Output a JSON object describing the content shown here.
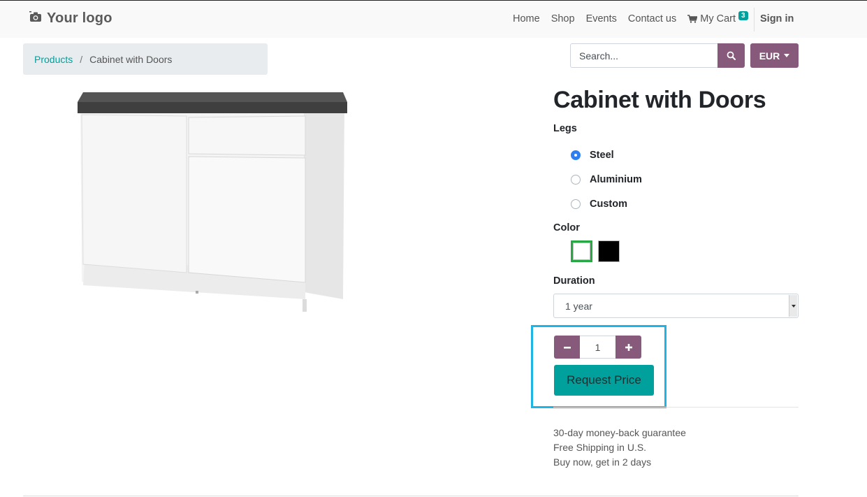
{
  "header": {
    "logo_text": "Your logo",
    "nav": [
      {
        "label": "Home"
      },
      {
        "label": "Shop"
      },
      {
        "label": "Events"
      },
      {
        "label": "Contact us"
      }
    ],
    "cart_label": "My Cart",
    "cart_count": "3",
    "signin_label": "Sign in"
  },
  "breadcrumb": {
    "root": "Products",
    "separator": "/",
    "current": "Cabinet with Doors"
  },
  "search": {
    "placeholder": "Search...",
    "currency": "EUR"
  },
  "product": {
    "title": "Cabinet with Doors",
    "legs_label": "Legs",
    "legs_options": [
      {
        "label": "Steel",
        "selected": true
      },
      {
        "label": "Aluminium",
        "selected": false
      },
      {
        "label": "Custom",
        "selected": false
      }
    ],
    "color_label": "Color",
    "colors": [
      {
        "name": "White",
        "hex": "#ffffff",
        "selected": true
      },
      {
        "name": "Black",
        "hex": "#000000",
        "selected": false
      }
    ],
    "duration_label": "Duration",
    "duration_value": "1 year",
    "quantity": "1",
    "request_label": "Request Price",
    "guarantees": [
      "30-day money-back guarantee",
      "Free Shipping in U.S.",
      "Buy now, get in 2 days"
    ]
  },
  "colors": {
    "primary": "#875a7b",
    "accent": "#00a09d",
    "highlight": "#1eb5e5",
    "radio_selected": "#2f7ff0"
  }
}
